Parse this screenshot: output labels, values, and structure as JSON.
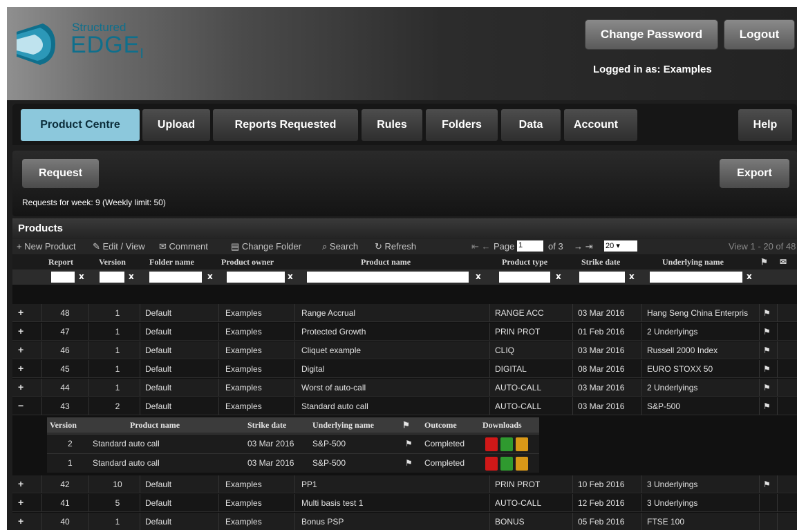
{
  "brand": {
    "line1": "Structured",
    "line2": "EDGE",
    "subscript": "I"
  },
  "header": {
    "change_password": "Change Password",
    "logout": "Logout",
    "logged_in": "Logged in as: Examples"
  },
  "nav": {
    "tabs": [
      "Product Centre",
      "Upload",
      "Reports Requested",
      "Rules",
      "Folders",
      "Data",
      "Account",
      "Help"
    ],
    "active": "Product Centre"
  },
  "actions": {
    "request": "Request",
    "export": "Export",
    "requests_info": "Requests for week: 9 (Weekly limit: 50)"
  },
  "grid": {
    "title": "Products",
    "toolbar": {
      "new_product": "New Product",
      "edit_view": "Edit / View",
      "comment": "Comment",
      "change_folder": "Change Folder",
      "search": "Search",
      "refresh": "Refresh",
      "page_label": "Page",
      "page_value": "1",
      "of_pages": "of 3",
      "page_size": "20",
      "view_range": "View 1 - 20 of 48"
    },
    "columns": [
      "Report",
      "Version",
      "Folder name",
      "Product owner",
      "Product name",
      "Product type",
      "Strike date",
      "Underlying name"
    ],
    "rows": [
      {
        "expand": "+",
        "report": "48",
        "version": "1",
        "folder": "Default",
        "owner": "Examples",
        "name": "Range Accrual",
        "type": "RANGE ACC",
        "strike": "03 Mar 2016",
        "underlying": "Hang Seng China Enterpris",
        "flag": "⚑"
      },
      {
        "expand": "+",
        "report": "47",
        "version": "1",
        "folder": "Default",
        "owner": "Examples",
        "name": "Protected Growth",
        "type": "PRIN PROT",
        "strike": "01 Feb 2016",
        "underlying": "2 Underlyings",
        "flag": "⚑"
      },
      {
        "expand": "+",
        "report": "46",
        "version": "1",
        "folder": "Default",
        "owner": "Examples",
        "name": "Cliquet example",
        "type": "CLIQ",
        "strike": "03 Mar 2016",
        "underlying": "Russell 2000 Index",
        "flag": "⚑"
      },
      {
        "expand": "+",
        "report": "45",
        "version": "1",
        "folder": "Default",
        "owner": "Examples",
        "name": "Digital",
        "type": "DIGITAL",
        "strike": "08 Mar 2016",
        "underlying": "EURO STOXX 50",
        "flag": "⚑"
      },
      {
        "expand": "+",
        "report": "44",
        "version": "1",
        "folder": "Default",
        "owner": "Examples",
        "name": "Worst of auto-call",
        "type": "AUTO-CALL",
        "strike": "03 Mar 2016",
        "underlying": "2 Underlyings",
        "flag": "⚑"
      },
      {
        "expand": "−",
        "report": "43",
        "version": "2",
        "folder": "Default",
        "owner": "Examples",
        "name": "Standard auto call",
        "type": "AUTO-CALL",
        "strike": "03 Mar 2016",
        "underlying": "S&P-500",
        "flag": "⚑"
      }
    ],
    "rows_after": [
      {
        "expand": "+",
        "report": "42",
        "version": "10",
        "folder": "Default",
        "owner": "Examples",
        "name": "PP1",
        "type": "PRIN PROT",
        "strike": "10 Feb 2016",
        "underlying": "3 Underlyings",
        "flag": "⚑"
      },
      {
        "expand": "+",
        "report": "41",
        "version": "5",
        "folder": "Default",
        "owner": "Examples",
        "name": "Multi basis test 1",
        "type": "AUTO-CALL",
        "strike": "12 Feb 2016",
        "underlying": "3 Underlyings",
        "flag": ""
      },
      {
        "expand": "+",
        "report": "40",
        "version": "1",
        "folder": "Default",
        "owner": "Examples",
        "name": "Bonus PSP",
        "type": "BONUS",
        "strike": "05 Feb 2016",
        "underlying": "FTSE 100",
        "flag": ""
      }
    ],
    "subgrid": {
      "columns": [
        "Version",
        "Product name",
        "Strike date",
        "Underlying name",
        "⚑",
        "Outcome",
        "Downloads"
      ],
      "rows": [
        {
          "version": "2",
          "name": "Standard auto call",
          "strike": "03 Mar 2016",
          "underlying": "S&P-500",
          "flag": "⚑",
          "outcome": "Completed"
        },
        {
          "version": "1",
          "name": "Standard auto call",
          "strike": "03 Mar 2016",
          "underlying": "S&P-500",
          "flag": "⚑",
          "outcome": "Completed"
        }
      ]
    }
  },
  "colors": {
    "active_tab": "#8cc8dc",
    "logo_blue": "#0f6f8c"
  }
}
